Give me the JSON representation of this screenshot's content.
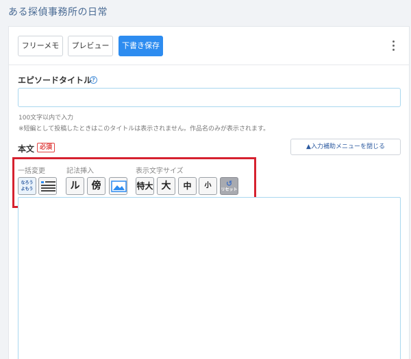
{
  "page": {
    "title": "ある探偵事務所の日常"
  },
  "toolbar": {
    "free_memo": "フリーメモ",
    "preview": "プレビュー",
    "save_draft": "下書き保存"
  },
  "episode_title": {
    "label": "エピソードタイトル",
    "value": "",
    "note1": "100文字以内で入力",
    "note2": "※短編として投稿したときはこのタイトルは表示されません。作品名のみが表示されます。"
  },
  "body": {
    "label": "本文",
    "required": "必須",
    "close_assist": "▲入力補助メニューを閉じる",
    "value": ""
  },
  "assist": {
    "groups": {
      "bulk": "一括変更",
      "notation": "記法挿入",
      "size": "表示文字サイズ"
    },
    "tools": {
      "narou_top": "なろう",
      "narou_bottom": "よもう",
      "ruby": "ルビ",
      "emphasis": "傍点",
      "size_xl": "特大",
      "size_l": "大",
      "size_m": "中",
      "size_s": "小",
      "reset": "リセット"
    }
  },
  "colors": {
    "accent": "#2d8cf0",
    "highlight": "#d6212f",
    "required": "#e0413f"
  }
}
